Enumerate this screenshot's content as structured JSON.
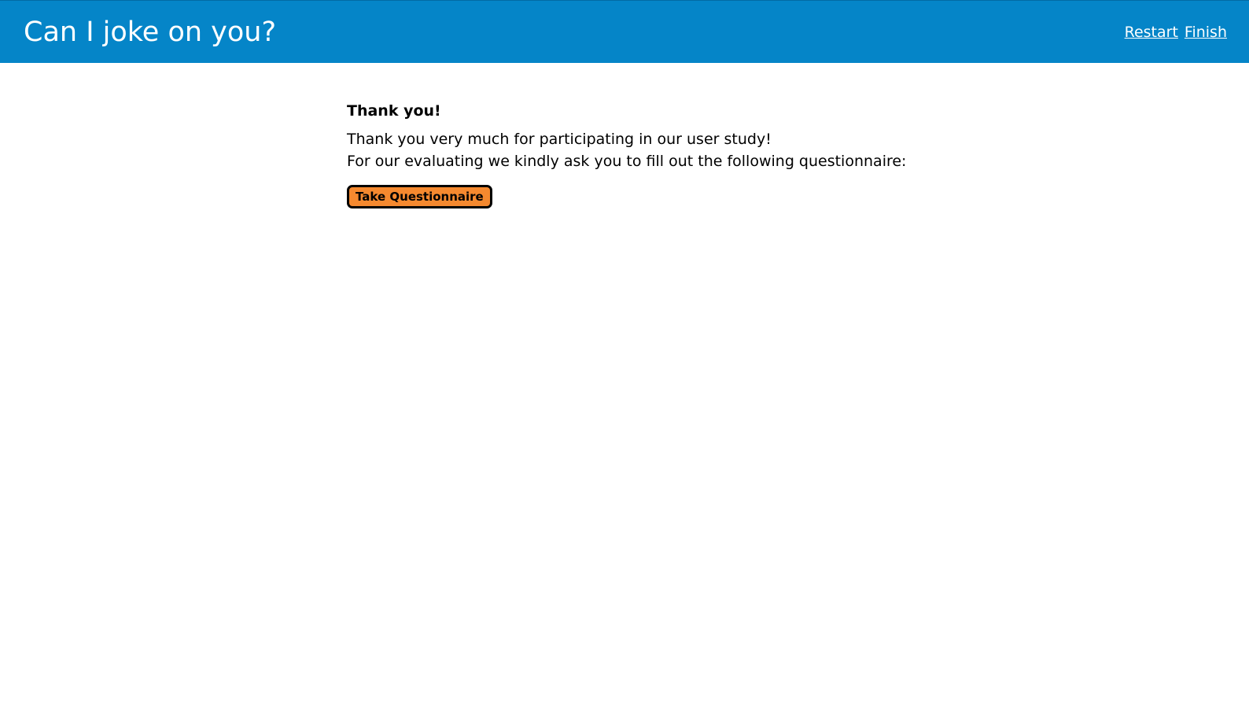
{
  "header": {
    "title": "Can I joke on you?",
    "nav": {
      "restart_label": "Restart",
      "finish_label": "Finish"
    },
    "color": "#0585c8"
  },
  "main": {
    "heading": "Thank you!",
    "message_lines": [
      "Thank you very much for participating in our user study!",
      "For our evaluating we kindly ask you to fill out the following questionnaire:"
    ],
    "questionnaire_button_label": "Take Questionnaire",
    "button_color": "#f5892f"
  }
}
